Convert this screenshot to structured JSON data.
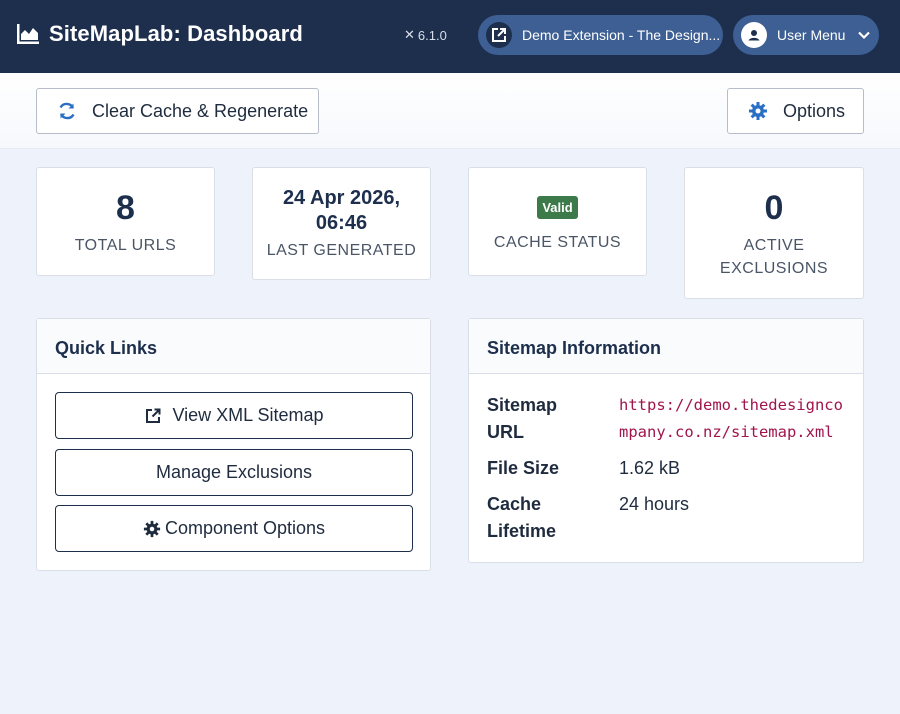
{
  "header": {
    "title": "SiteMapLab: Dashboard",
    "version": "6.1.0",
    "site_link": "Demo Extension - The Design...",
    "user_menu": "User Menu"
  },
  "toolbar": {
    "clear_label": "Clear Cache & Regenerate",
    "options_label": "Options"
  },
  "stats": {
    "total_urls": {
      "value": "8",
      "label": "TOTAL URLS"
    },
    "last_generated": {
      "value_line1": "24 Apr 2026,",
      "value_line2": "06:46",
      "label": "LAST GENERATED"
    },
    "cache_status": {
      "badge": "Valid",
      "label": "CACHE STATUS"
    },
    "active_exclusions": {
      "value": "0",
      "label_line1": "ACTIVE",
      "label_line2": "EXCLUSIONS"
    }
  },
  "quick_links": {
    "title": "Quick Links",
    "view_xml": "View XML Sitemap",
    "manage_exclusions": "Manage Exclusions",
    "component_options": "Component Options"
  },
  "sitemap_info": {
    "title": "Sitemap Information",
    "url_label_line1": "Sitemap",
    "url_label_line2": "URL",
    "url_value": "https://demo.thedesigncompany.co.nz/sitemap.xml",
    "size_label": "File Size",
    "size_value": "1.62 kB",
    "lifetime_label_line1": "Cache",
    "lifetime_label_line2": "Lifetime",
    "lifetime_value": "24 hours"
  },
  "colors": {
    "header_bg": "#1d2f4d",
    "pill_bg": "#3d5f93",
    "badge_green": "#3d7a4a",
    "url_color": "#a1144c",
    "page_bg": "#eef2fa"
  },
  "icons": {
    "brand": "chart-area-icon",
    "version": "joomla-icon",
    "site": "external-link-icon",
    "user": "user-circle-icon",
    "clear": "sync-icon",
    "options": "gear-icon"
  }
}
